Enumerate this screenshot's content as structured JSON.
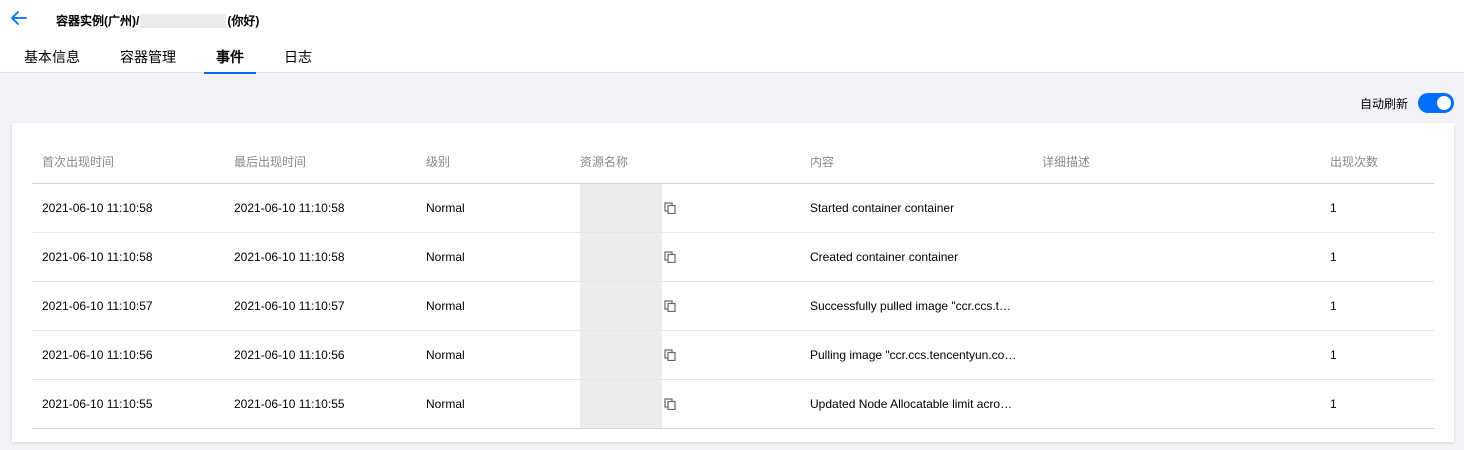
{
  "header": {
    "title_prefix": "容器实例(广州)/",
    "title_suffix": "(你好)",
    "tabs": [
      {
        "label": "基本信息",
        "active": false
      },
      {
        "label": "容器管理",
        "active": false
      },
      {
        "label": "事件",
        "active": true
      },
      {
        "label": "日志",
        "active": false
      }
    ]
  },
  "toolbar": {
    "auto_refresh_label": "自动刷新",
    "auto_refresh_on": true
  },
  "colors": {
    "accent": "#006eff",
    "background": "#f3f4f7"
  },
  "table": {
    "columns": [
      "首次出现时间",
      "最后出现时间",
      "级别",
      "资源名称",
      "内容",
      "详细描述",
      "出现次数"
    ],
    "rows": [
      {
        "first": "2021-06-10 11:10:58",
        "last": "2021-06-10 11:10:58",
        "level": "Normal",
        "content": "Started container container",
        "detail": "",
        "count": "1"
      },
      {
        "first": "2021-06-10 11:10:58",
        "last": "2021-06-10 11:10:58",
        "level": "Normal",
        "content": "Created container container",
        "detail": "",
        "count": "1"
      },
      {
        "first": "2021-06-10 11:10:57",
        "last": "2021-06-10 11:10:57",
        "level": "Normal",
        "content": "Successfully pulled image \"ccr.ccs.t…",
        "detail": "",
        "count": "1"
      },
      {
        "first": "2021-06-10 11:10:56",
        "last": "2021-06-10 11:10:56",
        "level": "Normal",
        "content": "Pulling image \"ccr.ccs.tencentyun.co…",
        "detail": "",
        "count": "1"
      },
      {
        "first": "2021-06-10 11:10:55",
        "last": "2021-06-10 11:10:55",
        "level": "Normal",
        "content": "Updated Node Allocatable limit acro…",
        "detail": "",
        "count": "1"
      }
    ]
  },
  "icons": {
    "back": "arrow-left-icon",
    "copy": "copy-icon"
  }
}
